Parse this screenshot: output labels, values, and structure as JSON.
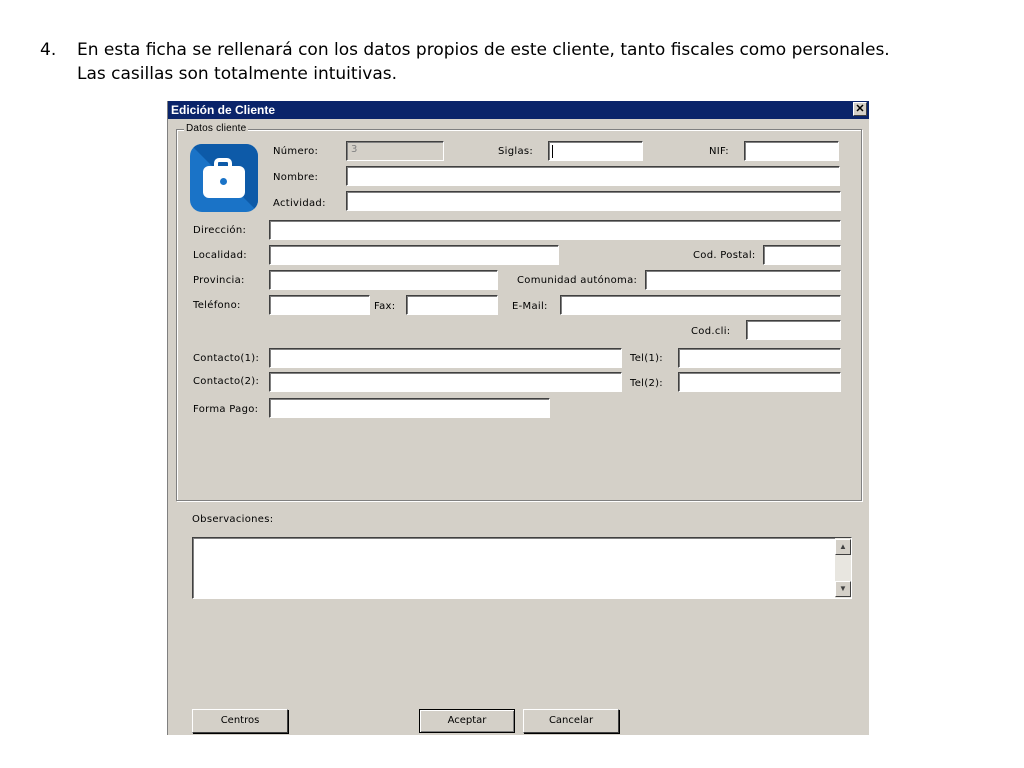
{
  "slide": {
    "number": "4.",
    "line1": "En esta ficha se rellenará con los datos propios de este cliente, tanto fiscales como personales.",
    "line2": "Las casillas son totalmente intuitivas."
  },
  "dialog": {
    "title": "Edición de Cliente",
    "close_glyph": "✕",
    "group_label": "Datos cliente",
    "logo_icon": "briefcase-icon",
    "fields": {
      "numero": {
        "label": "Número:",
        "value": "3"
      },
      "siglas": {
        "label": "Siglas:",
        "value": ""
      },
      "nif": {
        "label": "NIF:",
        "value": ""
      },
      "nombre": {
        "label": "Nombre:",
        "value": ""
      },
      "actividad": {
        "label": "Actividad:",
        "value": ""
      },
      "direccion": {
        "label": "Dirección:",
        "value": ""
      },
      "localidad": {
        "label": "Localidad:",
        "value": ""
      },
      "cod_postal": {
        "label": "Cod. Postal:",
        "value": ""
      },
      "provincia": {
        "label": "Provincia:",
        "value": ""
      },
      "comunidad": {
        "label": "Comunidad autónoma:",
        "value": ""
      },
      "telefono": {
        "label": "Teléfono:",
        "value": ""
      },
      "fax": {
        "label": "Fax:",
        "value": ""
      },
      "email": {
        "label": "E-Mail:",
        "value": ""
      },
      "codcli": {
        "label": "Cod.cli:",
        "value": ""
      },
      "contacto1": {
        "label": "Contacto(1):",
        "value": ""
      },
      "tel1": {
        "label": "Tel(1):",
        "value": ""
      },
      "contacto2": {
        "label": "Contacto(2):",
        "value": ""
      },
      "tel2": {
        "label": "Tel(2):",
        "value": ""
      },
      "forma_pago": {
        "label": "Forma Pago:",
        "value": ""
      }
    },
    "observaciones": {
      "label": "Observaciones:",
      "value": ""
    },
    "scroll_up_glyph": "▲",
    "scroll_down_glyph": "▼",
    "buttons": {
      "centros": "Centros",
      "aceptar": "Aceptar",
      "cancelar": "Cancelar"
    }
  }
}
